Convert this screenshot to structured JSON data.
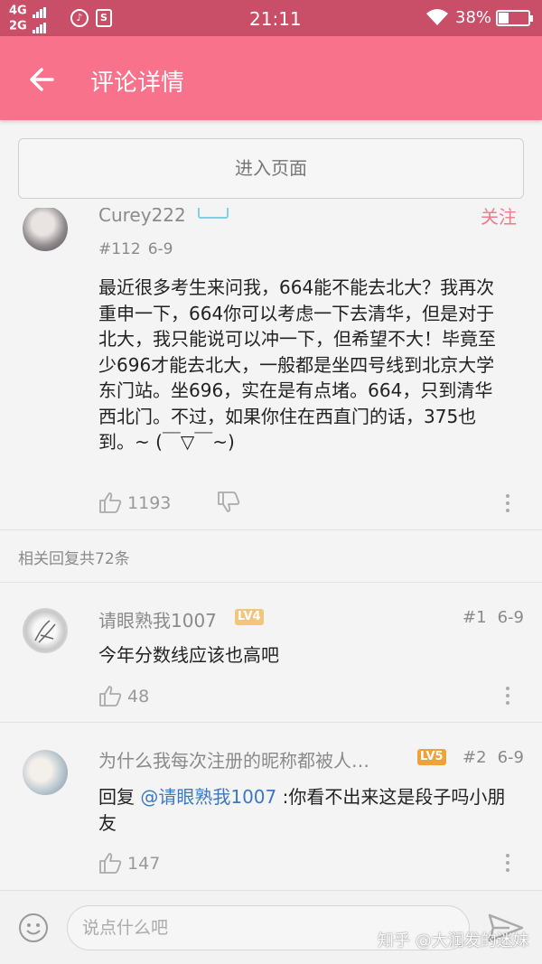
{
  "status_bar": {
    "net1": "4G",
    "net2": "2G",
    "app1_icon": "netease-music-icon",
    "app2_icon": "s-app-icon",
    "app2_label": "S",
    "time": "21:11",
    "battery": "38%",
    "battery_level": 0.38
  },
  "app_bar": {
    "title": "评论详情"
  },
  "enter_page_label": "进入页面",
  "main_comment": {
    "author": "Curey222",
    "follow_label": "关注",
    "floor": "#112",
    "date": "6-9",
    "text": "最近很多考生来问我，664能不能去北大？我再次重申一下，664你可以考虑一下去清华，但是对于北大，我只能说可以冲一下，但希望不大！毕竟至少696才能去北大，一般都是坐四号线到北京大学东门站。坐696，实在是有点堵。664，只到清华西北门。不过，如果你住在西直门的话，375也到。~ (￣▽￣~)",
    "likes": "1193"
  },
  "replies_header": "相关回复共72条",
  "replies": [
    {
      "author": "请眼熟我1007",
      "level": "LV4",
      "floor": "#1",
      "date": "6-9",
      "text": "今年分数线应该也高吧",
      "likes": "48"
    },
    {
      "author": "为什么我每次注册的昵称都被人…",
      "level": "LV5",
      "floor": "#2",
      "date": "6-9",
      "reply_prefix": "回复 ",
      "mention": "@请眼熟我1007",
      "text": " :你看不出来这是段子吗小朋友",
      "likes": "147"
    }
  ],
  "input": {
    "placeholder": "说点什么吧"
  },
  "watermark": "知乎 @大润发的迷妹",
  "colors": {
    "status_bar": "#c94f68",
    "app_bar": "#f7728a",
    "mention": "#3b79c4",
    "follow": "#f07a8e"
  }
}
